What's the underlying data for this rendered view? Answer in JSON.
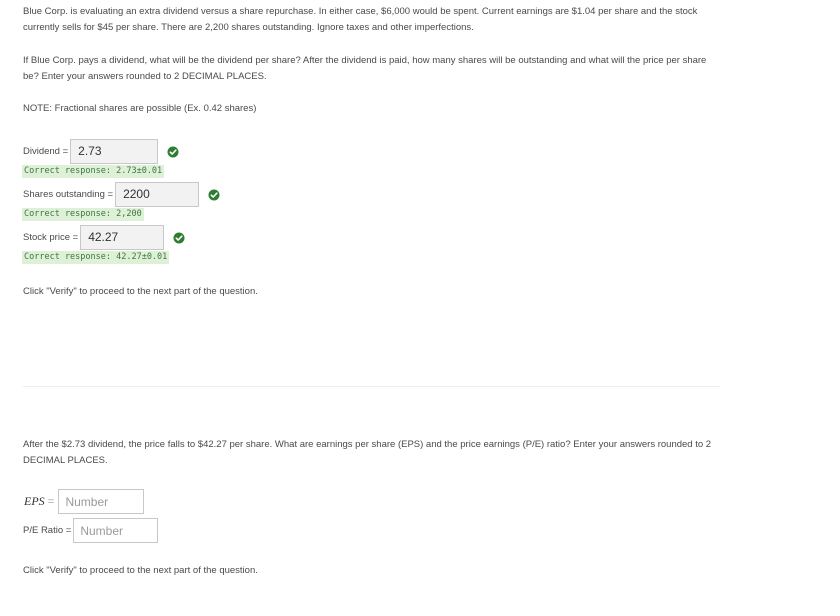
{
  "intro": {
    "text": "Blue Corp. is evaluating an extra dividend versus a share repurchase. In either case, $6,000 would be spent. Current earnings are $1.04 per share and the stock currently sells for $45 per share. There are 2,200 shares outstanding. Ignore taxes and other imperfections."
  },
  "part1": {
    "question": "If Blue Corp. pays a dividend, what will be the dividend per share? After the dividend is paid, how many shares will be outstanding and what will the price per share be? Enter your answers rounded to 2 DECIMAL PLACES.",
    "note": "NOTE: Fractional shares are possible (Ex. 0.42 shares)",
    "fields": [
      {
        "label": "Dividend =",
        "value": "2.73",
        "correct_response": "Correct response: 2.73±0.01"
      },
      {
        "label": "Shares outstanding =",
        "value": "2200",
        "correct_response": "Correct response: 2,200"
      },
      {
        "label": "Stock price =",
        "value": "42.27",
        "correct_response": "Correct response: 42.27±0.01"
      }
    ],
    "verify_note": "Click \"Verify\" to proceed to the next part of the question."
  },
  "part2": {
    "question": "After the $2.73 dividend, the price falls to $42.27 per share.  What are earnings per share (EPS) and the price earnings (P/E) ratio? Enter your answers rounded to 2 DECIMAL PLACES.",
    "eps_label": "EPS",
    "eps_eq": "=",
    "eps_placeholder": "Number",
    "pe_label": "P/E Ratio =",
    "pe_placeholder": "Number",
    "verify_note": "Click \"Verify\" to proceed to the next part of the question."
  },
  "colors": {
    "correct_green": "#2e7d32",
    "response_bg": "#dff0d8",
    "response_text": "#3c763d"
  }
}
